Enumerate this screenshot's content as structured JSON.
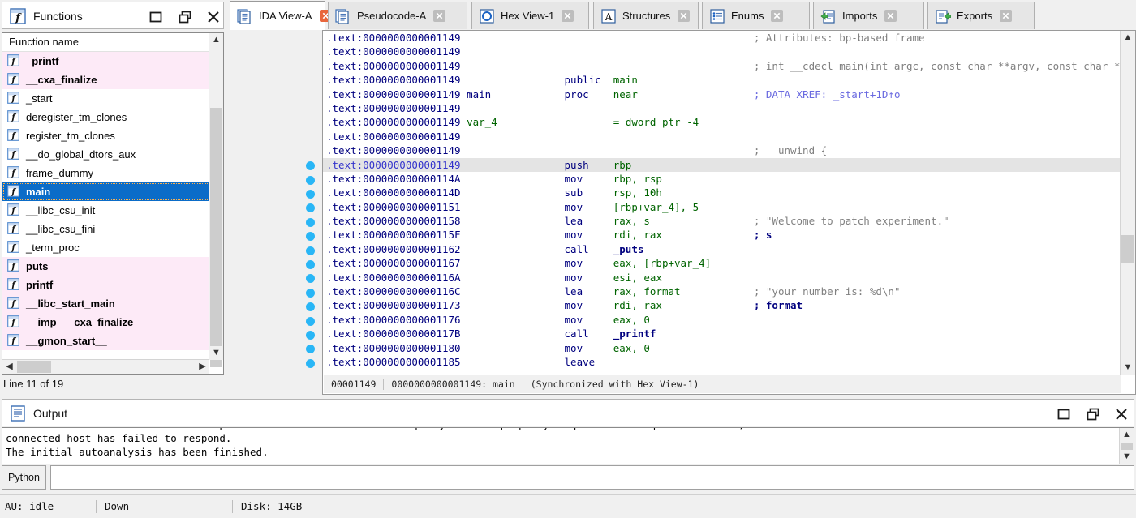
{
  "functions_panel": {
    "title": "Functions",
    "title_icon": "function-f-icon",
    "column_header": "Function name",
    "status": "Line 11 of 19",
    "window_buttons": [
      {
        "name": "maximize",
        "glyph": "square"
      },
      {
        "name": "restore",
        "glyph": "restore"
      },
      {
        "name": "close",
        "glyph": "x"
      }
    ],
    "items": [
      {
        "label": "_printf",
        "style": "import"
      },
      {
        "label": "__cxa_finalize",
        "style": "import"
      },
      {
        "label": "_start",
        "style": "normal"
      },
      {
        "label": "deregister_tm_clones",
        "style": "normal"
      },
      {
        "label": "register_tm_clones",
        "style": "normal"
      },
      {
        "label": "__do_global_dtors_aux",
        "style": "normal"
      },
      {
        "label": "frame_dummy",
        "style": "normal"
      },
      {
        "label": "main",
        "style": "selected"
      },
      {
        "label": "__libc_csu_init",
        "style": "normal"
      },
      {
        "label": "__libc_csu_fini",
        "style": "normal"
      },
      {
        "label": "_term_proc",
        "style": "normal"
      },
      {
        "label": "puts",
        "style": "import"
      },
      {
        "label": "printf",
        "style": "import"
      },
      {
        "label": "__libc_start_main",
        "style": "import"
      },
      {
        "label": "__imp___cxa_finalize",
        "style": "import"
      },
      {
        "label": "__gmon_start__",
        "style": "import"
      }
    ]
  },
  "tabs": [
    {
      "label": "IDA View-A",
      "icon": "document-view-icon",
      "active": true
    },
    {
      "label": "Pseudocode-A",
      "icon": "document-view-icon",
      "active": false
    },
    {
      "label": "Hex View-1",
      "icon": "hex-circle-icon",
      "active": false
    },
    {
      "label": "Structures",
      "icon": "struct-a-icon",
      "active": false
    },
    {
      "label": "Enums",
      "icon": "enum-list-icon",
      "active": false
    },
    {
      "label": "Imports",
      "icon": "imports-icon",
      "active": false
    },
    {
      "label": "Exports",
      "icon": "exports-icon",
      "active": false
    }
  ],
  "disassembly": {
    "lines": [
      {
        "addr": ".text:0000000000001149",
        "name": "",
        "mnemonic": "",
        "operands": "",
        "comment": "; Attributes: bp-based frame",
        "comment_kind": "plain",
        "highlight": false,
        "dot": false
      },
      {
        "addr": ".text:0000000000001149",
        "name": "",
        "mnemonic": "",
        "operands": "",
        "comment": "",
        "comment_kind": "plain",
        "highlight": false,
        "dot": false
      },
      {
        "addr": ".text:0000000000001149",
        "name": "",
        "mnemonic": "",
        "operands": "",
        "comment": "; int __cdecl main(int argc, const char **argv, const char **envp)",
        "comment_kind": "plain",
        "highlight": false,
        "dot": false
      },
      {
        "addr": ".text:0000000000001149",
        "name": "",
        "mnemonic": "public",
        "operands": "main",
        "comment": "",
        "comment_kind": "plain",
        "highlight": false,
        "dot": false
      },
      {
        "addr": ".text:0000000000001149",
        "name": "main",
        "mnemonic": "proc",
        "operands": "near",
        "comment": "; DATA XREF: _start+1D↑o",
        "comment_kind": "xref",
        "highlight": false,
        "dot": false
      },
      {
        "addr": ".text:0000000000001149",
        "name": "",
        "mnemonic": "",
        "operands": "",
        "comment": "",
        "comment_kind": "plain",
        "highlight": false,
        "dot": false
      },
      {
        "addr": ".text:0000000000001149",
        "name": "var_4",
        "mnemonic": "",
        "operands": "= dword ptr -4",
        "comment": "",
        "comment_kind": "plain",
        "highlight": false,
        "dot": false,
        "name_green": true
      },
      {
        "addr": ".text:0000000000001149",
        "name": "",
        "mnemonic": "",
        "operands": "",
        "comment": "",
        "comment_kind": "plain",
        "highlight": false,
        "dot": false
      },
      {
        "addr": ".text:0000000000001149",
        "name": "",
        "mnemonic": "",
        "operands": "",
        "comment": "; __unwind {",
        "comment_kind": "plain",
        "highlight": false,
        "dot": false
      },
      {
        "addr": ".text:0000000000001149",
        "name": "",
        "mnemonic": "push",
        "operands": "rbp",
        "comment": "",
        "comment_kind": "plain",
        "highlight": true,
        "dot": true
      },
      {
        "addr": ".text:000000000000114A",
        "name": "",
        "mnemonic": "mov",
        "operands": "rbp, rsp",
        "comment": "",
        "comment_kind": "plain",
        "highlight": false,
        "dot": true
      },
      {
        "addr": ".text:000000000000114D",
        "name": "",
        "mnemonic": "sub",
        "operands": "rsp, 10h",
        "comment": "",
        "comment_kind": "plain",
        "highlight": false,
        "dot": true
      },
      {
        "addr": ".text:0000000000001151",
        "name": "",
        "mnemonic": "mov",
        "operands": "[rbp+var_4], 5",
        "comment": "",
        "comment_kind": "plain",
        "highlight": false,
        "dot": true
      },
      {
        "addr": ".text:0000000000001158",
        "name": "",
        "mnemonic": "lea",
        "operands": "rax, s",
        "comment": "; \"Welcome to patch experiment.\"",
        "comment_kind": "plain",
        "highlight": false,
        "dot": true
      },
      {
        "addr": ".text:000000000000115F",
        "name": "",
        "mnemonic": "mov",
        "operands": "rdi, rax",
        "comment": "; s",
        "comment_kind": "symbol",
        "highlight": false,
        "dot": true
      },
      {
        "addr": ".text:0000000000001162",
        "name": "",
        "mnemonic": "call",
        "operands": "_puts",
        "comment": "",
        "comment_kind": "plain",
        "highlight": false,
        "dot": true,
        "op_sym": true
      },
      {
        "addr": ".text:0000000000001167",
        "name": "",
        "mnemonic": "mov",
        "operands": "eax, [rbp+var_4]",
        "comment": "",
        "comment_kind": "plain",
        "highlight": false,
        "dot": true
      },
      {
        "addr": ".text:000000000000116A",
        "name": "",
        "mnemonic": "mov",
        "operands": "esi, eax",
        "comment": "",
        "comment_kind": "plain",
        "highlight": false,
        "dot": true
      },
      {
        "addr": ".text:000000000000116C",
        "name": "",
        "mnemonic": "lea",
        "operands": "rax, format",
        "comment": "; \"your number is: %d\\n\"",
        "comment_kind": "plain",
        "highlight": false,
        "dot": true
      },
      {
        "addr": ".text:0000000000001173",
        "name": "",
        "mnemonic": "mov",
        "operands": "rdi, rax",
        "comment": "; format",
        "comment_kind": "symbol",
        "highlight": false,
        "dot": true
      },
      {
        "addr": ".text:0000000000001176",
        "name": "",
        "mnemonic": "mov",
        "operands": "eax, 0",
        "comment": "",
        "comment_kind": "plain",
        "highlight": false,
        "dot": true
      },
      {
        "addr": ".text:000000000000117B",
        "name": "",
        "mnemonic": "call",
        "operands": "_printf",
        "comment": "",
        "comment_kind": "plain",
        "highlight": false,
        "dot": true,
        "op_sym": true
      },
      {
        "addr": ".text:0000000000001180",
        "name": "",
        "mnemonic": "mov",
        "operands": "eax, 0",
        "comment": "",
        "comment_kind": "plain",
        "highlight": false,
        "dot": true
      },
      {
        "addr": ".text:0000000000001185",
        "name": "",
        "mnemonic": "leave",
        "operands": "",
        "comment": "",
        "comment_kind": "plain",
        "highlight": false,
        "dot": true
      }
    ],
    "status": [
      "00001149",
      "0000000000001149: main",
      "(Synchronized with Hex View-1)"
    ]
  },
  "output_panel": {
    "title": "Output",
    "title_icon": "output-document-icon",
    "lines": [
      "lumina: connect: A connection attempt failed because the connected party did not properly respond after a period of time, or established connection failed because",
      "connected host has failed to respond.",
      "The initial autoanalysis has been finished."
    ],
    "python_button": "Python",
    "python_input_value": ""
  },
  "bottom_status": {
    "au": "AU: idle",
    "down": "Down",
    "disk": "Disk: 14GB"
  },
  "colors": {
    "address": "#00007f",
    "operand_green": "#006400",
    "comment_gray": "#808080",
    "xref_purple": "#6a6ae0",
    "selection_blue": "#0b6cc8",
    "import_pink": "#fdeaf7",
    "breakpoint_dot": "#29b6f6",
    "active_tab_close": "#e8663c"
  }
}
